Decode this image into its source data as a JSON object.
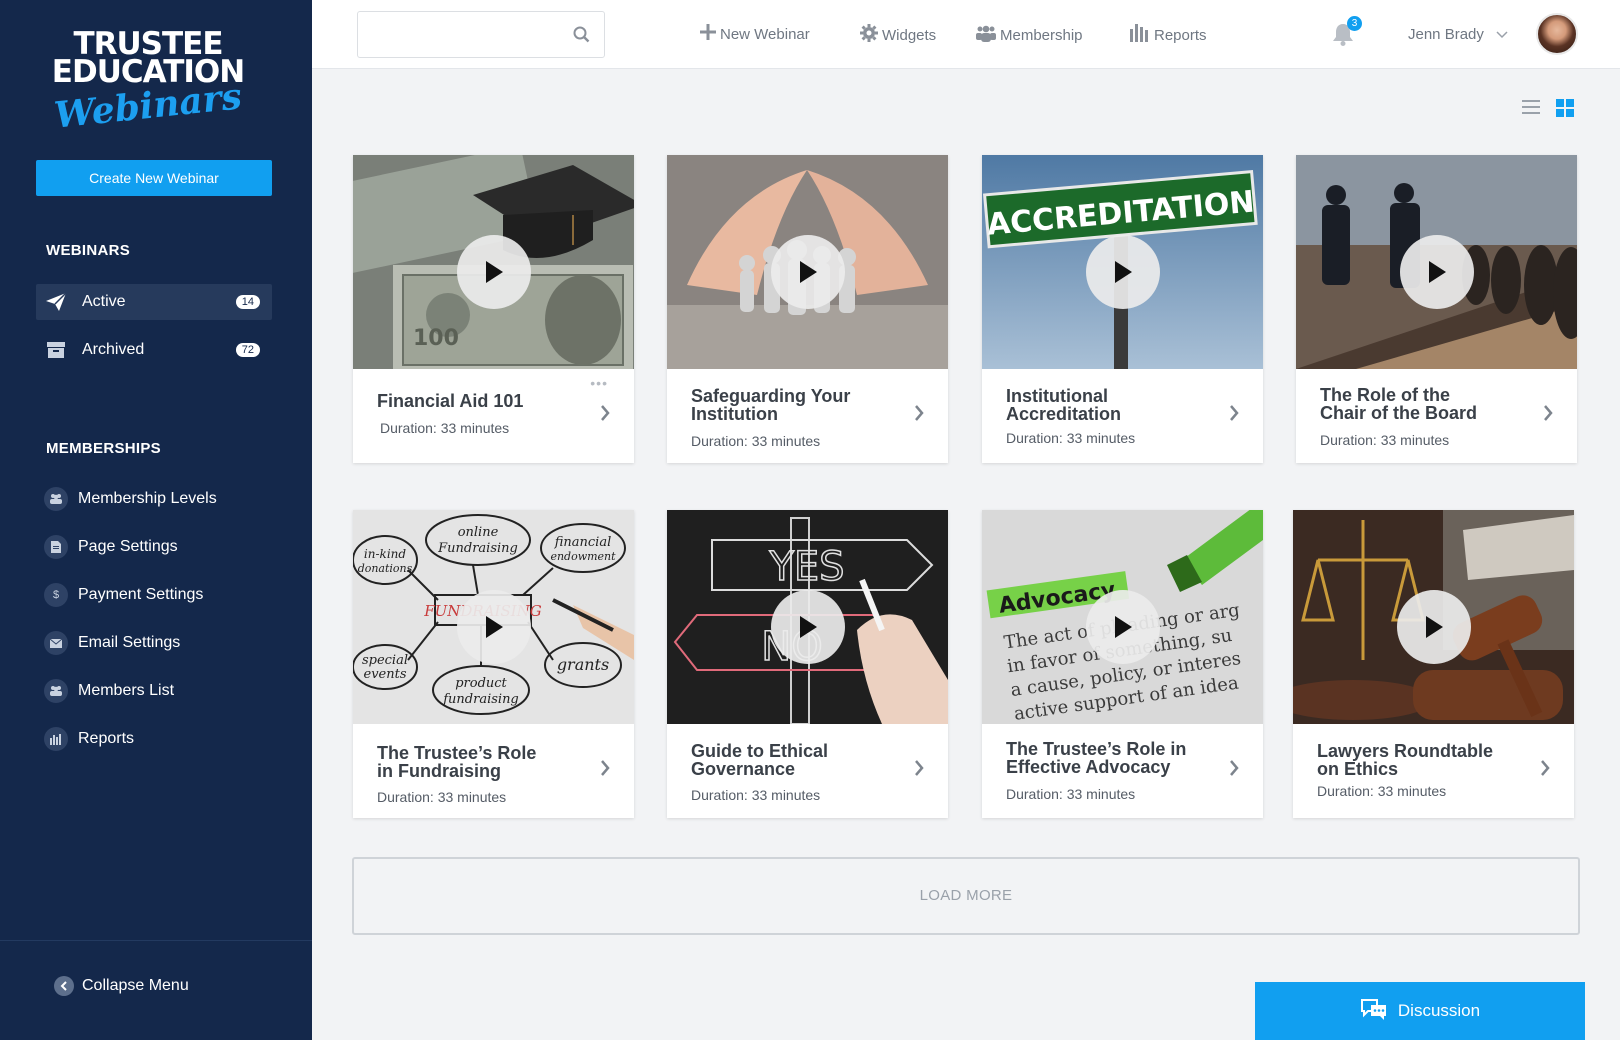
{
  "brand": {
    "line1": "TRUSTEE",
    "line2": "EDUCATION",
    "script": "Webinars"
  },
  "sidebar": {
    "create_button": "Create New Webinar",
    "webinars_title": "WEBINARS",
    "webinar_items": [
      {
        "label": "Active",
        "count": "14"
      },
      {
        "label": "Archived",
        "count": "72"
      }
    ],
    "memberships_title": "MEMBERSHIPS",
    "membership_items": [
      {
        "label": "Membership Levels",
        "icon": "users-icon"
      },
      {
        "label": "Page Settings",
        "icon": "page-icon"
      },
      {
        "label": "Payment Settings",
        "icon": "dollar-icon"
      },
      {
        "label": "Email Settings",
        "icon": "envelope-icon"
      },
      {
        "label": "Members List",
        "icon": "users-icon"
      },
      {
        "label": "Reports",
        "icon": "bar-chart-icon"
      }
    ],
    "collapse_label": "Collapse Menu"
  },
  "topbar": {
    "search_placeholder": "",
    "nav": [
      {
        "label": "New Webinar",
        "icon": "plus-icon"
      },
      {
        "label": "Widgets",
        "icon": "gear-icon"
      },
      {
        "label": "Membership",
        "icon": "users-icon"
      },
      {
        "label": "Reports",
        "icon": "bar-chart-icon"
      }
    ],
    "notification_count": "3",
    "user_name": "Jenn Brady"
  },
  "webinars": [
    {
      "title_line1": "Financial Aid 101",
      "title_line2": "",
      "duration": "Duration: 33 minutes"
    },
    {
      "title_line1": "Safeguarding Your",
      "title_line2": "Institution",
      "duration": "Duration: 33 minutes"
    },
    {
      "title_line1": "Institutional",
      "title_line2": "Accreditation",
      "duration": "Duration: 33 minutes"
    },
    {
      "title_line1": "The Role of the",
      "title_line2": "Chair of the Board",
      "duration": "Duration: 33 minutes"
    },
    {
      "title_line1": "The Trustee’s Role",
      "title_line2": "in Fundraising",
      "duration": "Duration: 33 minutes"
    },
    {
      "title_line1": "Guide to Ethical",
      "title_line2": "Governance",
      "duration": "Duration: 33 minutes"
    },
    {
      "title_line1": "The Trustee’s Role in",
      "title_line2": "Effective Advocacy",
      "duration": "Duration: 33 minutes"
    },
    {
      "title_line1": "Lawyers Roundtable",
      "title_line2": "on Ethics",
      "duration": "Duration: 33 minutes"
    }
  ],
  "thumb_text": {
    "accreditation": "ACCREDITATION",
    "fund_online": "online",
    "fund_fundraising": "Fundraising",
    "fund_financial": "financial",
    "fund_endowment": "endowment",
    "fund_inkind": "in-kind",
    "fund_donations": "donations",
    "fund_center": "FUNDRAISING",
    "fund_special": "special",
    "fund_events": "events",
    "fund_product": "product",
    "fund_product2": "fundraising",
    "fund_grants": "grants",
    "yes": "YES",
    "no": "NO",
    "advocacy_word": "Advocacy",
    "advocacy_l1": "The act of pleading or arg",
    "advocacy_l2": "in favor of something, su",
    "advocacy_l3": "a cause, policy, or interes",
    "advocacy_l4": "active support of an idea"
  },
  "load_more": "LOAD MORE",
  "discussion": "Discussion"
}
